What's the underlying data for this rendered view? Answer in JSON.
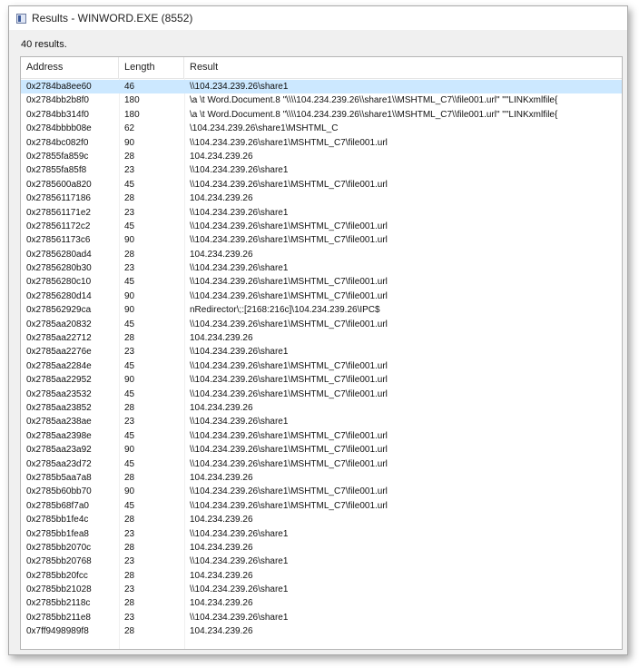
{
  "window": {
    "title": "Results - WINWORD.EXE (8552)",
    "icon": "window-app-icon"
  },
  "summary": {
    "count_text": "40 results."
  },
  "table": {
    "columns": [
      "Address",
      "Length",
      "Result"
    ],
    "selected_row": 0,
    "rows": [
      [
        "0x2784ba8ee60",
        "46",
        "\\\\104.234.239.26\\share1"
      ],
      [
        "0x2784bb2b8f0",
        "180",
        "\\a \\t Word.Document.8 \"\\\\\\\\104.234.239.26\\\\share1\\\\MSHTML_C7\\\\file001.url\" \"\"LINKxmlfile{"
      ],
      [
        "0x2784bb314f0",
        "180",
        "\\a \\t Word.Document.8 \"\\\\\\\\104.234.239.26\\\\share1\\\\MSHTML_C7\\\\file001.url\" \"\"LINKxmlfile{"
      ],
      [
        "0x2784bbbb08e",
        "62",
        "\\104.234.239.26\\share1\\MSHTML_C"
      ],
      [
        "0x2784bc082f0",
        "90",
        "\\\\104.234.239.26\\share1\\MSHTML_C7\\file001.url"
      ],
      [
        "0x27855fa859c",
        "28",
        "104.234.239.26"
      ],
      [
        "0x27855fa85f8",
        "23",
        "\\\\104.234.239.26\\share1"
      ],
      [
        "0x2785600a820",
        "45",
        "\\\\104.234.239.26\\share1\\MSHTML_C7\\file001.url"
      ],
      [
        "0x27856117186",
        "28",
        "104.234.239.26"
      ],
      [
        "0x278561171e2",
        "23",
        "\\\\104.234.239.26\\share1"
      ],
      [
        "0x278561172c2",
        "45",
        "\\\\104.234.239.26\\share1\\MSHTML_C7\\file001.url"
      ],
      [
        "0x278561173c6",
        "90",
        "\\\\104.234.239.26\\share1\\MSHTML_C7\\file001.url"
      ],
      [
        "0x27856280ad4",
        "28",
        "104.234.239.26"
      ],
      [
        "0x27856280b30",
        "23",
        "\\\\104.234.239.26\\share1"
      ],
      [
        "0x27856280c10",
        "45",
        "\\\\104.234.239.26\\share1\\MSHTML_C7\\file001.url"
      ],
      [
        "0x27856280d14",
        "90",
        "\\\\104.234.239.26\\share1\\MSHTML_C7\\file001.url"
      ],
      [
        "0x278562929ca",
        "90",
        "nRedirector\\;:[2168:216c]\\104.234.239.26\\IPC$"
      ],
      [
        "0x2785aa20832",
        "45",
        "\\\\104.234.239.26\\share1\\MSHTML_C7\\file001.url"
      ],
      [
        "0x2785aa22712",
        "28",
        "104.234.239.26"
      ],
      [
        "0x2785aa2276e",
        "23",
        "\\\\104.234.239.26\\share1"
      ],
      [
        "0x2785aa2284e",
        "45",
        "\\\\104.234.239.26\\share1\\MSHTML_C7\\file001.url"
      ],
      [
        "0x2785aa22952",
        "90",
        "\\\\104.234.239.26\\share1\\MSHTML_C7\\file001.url"
      ],
      [
        "0x2785aa23532",
        "45",
        "\\\\104.234.239.26\\share1\\MSHTML_C7\\file001.url"
      ],
      [
        "0x2785aa23852",
        "28",
        "104.234.239.26"
      ],
      [
        "0x2785aa238ae",
        "23",
        "\\\\104.234.239.26\\share1"
      ],
      [
        "0x2785aa2398e",
        "45",
        "\\\\104.234.239.26\\share1\\MSHTML_C7\\file001.url"
      ],
      [
        "0x2785aa23a92",
        "90",
        "\\\\104.234.239.26\\share1\\MSHTML_C7\\file001.url"
      ],
      [
        "0x2785aa23d72",
        "45",
        "\\\\104.234.239.26\\share1\\MSHTML_C7\\file001.url"
      ],
      [
        "0x2785b5aa7a8",
        "28",
        "104.234.239.26"
      ],
      [
        "0x2785b60bb70",
        "90",
        "\\\\104.234.239.26\\share1\\MSHTML_C7\\file001.url"
      ],
      [
        "0x2785b68f7a0",
        "45",
        "\\\\104.234.239.26\\share1\\MSHTML_C7\\file001.url"
      ],
      [
        "0x2785bb1fe4c",
        "28",
        "104.234.239.26"
      ],
      [
        "0x2785bb1fea8",
        "23",
        "\\\\104.234.239.26\\share1"
      ],
      [
        "0x2785bb2070c",
        "28",
        "104.234.239.26"
      ],
      [
        "0x2785bb20768",
        "23",
        "\\\\104.234.239.26\\share1"
      ],
      [
        "0x2785bb20fcc",
        "28",
        "104.234.239.26"
      ],
      [
        "0x2785bb21028",
        "23",
        "\\\\104.234.239.26\\share1"
      ],
      [
        "0x2785bb2118c",
        "28",
        "104.234.239.26"
      ],
      [
        "0x2785bb211e8",
        "23",
        "\\\\104.234.239.26\\share1"
      ],
      [
        "0x7ff9498989f8",
        "28",
        "104.234.239.26"
      ]
    ]
  }
}
